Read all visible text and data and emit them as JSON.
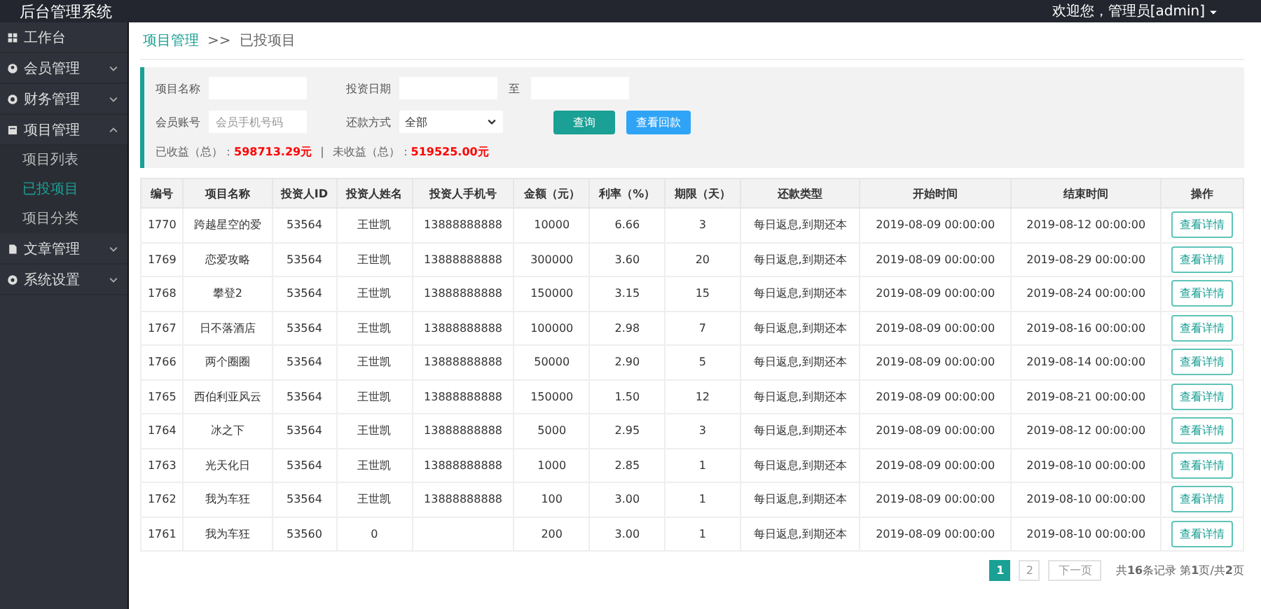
{
  "header": {
    "title": "后台管理系统",
    "user": "欢迎您，管理员[admin]"
  },
  "sidebar": {
    "items": [
      {
        "label": "工作台"
      },
      {
        "label": "会员管理",
        "expanded": false
      },
      {
        "label": "财务管理",
        "expanded": false
      },
      {
        "label": "项目管理",
        "expanded": true,
        "children": [
          {
            "label": "项目列表",
            "selected": false
          },
          {
            "label": "已投项目",
            "selected": true
          },
          {
            "label": "项目分类",
            "selected": false
          }
        ]
      },
      {
        "label": "文章管理",
        "expanded": false
      },
      {
        "label": "系统设置",
        "expanded": false
      }
    ]
  },
  "breadcrumb": {
    "parent": "项目管理",
    "separator": ">>",
    "current": "已投项目"
  },
  "filter": {
    "name_label": "项目名称",
    "date_label": "投资日期",
    "date_to": "至",
    "account_label": "会员账号",
    "account_placeholder": "会员手机号码",
    "repay_label": "还款方式",
    "repay_value": "全部",
    "buttons": [
      {
        "label": "查询",
        "kind": "primary"
      },
      {
        "label": "查看回款",
        "kind": "info"
      }
    ],
    "summary": {
      "earned_label": "已收益（总）：",
      "earned_value": "598713.29元",
      "divider": "|",
      "pending_label": "未收益（总）：",
      "pending_value": "519525.00元"
    }
  },
  "table": {
    "columns": [
      "编号",
      "项目名称",
      "投资人ID",
      "投资人姓名",
      "投资人手机号",
      "金额（元）",
      "利率（%）",
      "期限（天）",
      "还款类型",
      "开始时间",
      "结束时间",
      "操作"
    ],
    "rows": [
      [
        "1770",
        "跨越星空的爱",
        "53564",
        "王世凯",
        "13888888888",
        "10000",
        "6.66",
        "3",
        "每日返息,到期还本",
        "2019-08-09 00:00:00",
        "2019-08-12 00:00:00",
        "查看详情"
      ],
      [
        "1769",
        "恋爱攻略",
        "53564",
        "王世凯",
        "13888888888",
        "300000",
        "3.60",
        "20",
        "每日返息,到期还本",
        "2019-08-09 00:00:00",
        "2019-08-29 00:00:00",
        "查看详情"
      ],
      [
        "1768",
        "攀登2",
        "53564",
        "王世凯",
        "13888888888",
        "150000",
        "3.15",
        "15",
        "每日返息,到期还本",
        "2019-08-09 00:00:00",
        "2019-08-24 00:00:00",
        "查看详情"
      ],
      [
        "1767",
        "日不落酒店",
        "53564",
        "王世凯",
        "13888888888",
        "100000",
        "2.98",
        "7",
        "每日返息,到期还本",
        "2019-08-09 00:00:00",
        "2019-08-16 00:00:00",
        "查看详情"
      ],
      [
        "1766",
        "两个圈圈",
        "53564",
        "王世凯",
        "13888888888",
        "50000",
        "2.90",
        "5",
        "每日返息,到期还本",
        "2019-08-09 00:00:00",
        "2019-08-14 00:00:00",
        "查看详情"
      ],
      [
        "1765",
        "西伯利亚风云",
        "53564",
        "王世凯",
        "13888888888",
        "150000",
        "1.50",
        "12",
        "每日返息,到期还本",
        "2019-08-09 00:00:00",
        "2019-08-21 00:00:00",
        "查看详情"
      ],
      [
        "1764",
        "冰之下",
        "53564",
        "王世凯",
        "13888888888",
        "5000",
        "2.95",
        "3",
        "每日返息,到期还本",
        "2019-08-09 00:00:00",
        "2019-08-12 00:00:00",
        "查看详情"
      ],
      [
        "1763",
        "光天化日",
        "53564",
        "王世凯",
        "13888888888",
        "1000",
        "2.85",
        "1",
        "每日返息,到期还本",
        "2019-08-09 00:00:00",
        "2019-08-10 00:00:00",
        "查看详情"
      ],
      [
        "1762",
        "我为车狂",
        "53564",
        "王世凯",
        "13888888888",
        "100",
        "3.00",
        "1",
        "每日返息,到期还本",
        "2019-08-09 00:00:00",
        "2019-08-10 00:00:00",
        "查看详情"
      ],
      [
        "1761",
        "我为车狂",
        "53560",
        "0",
        "",
        "200",
        "3.00",
        "1",
        "每日返息,到期还本",
        "2019-08-09 00:00:00",
        "2019-08-10 00:00:00",
        "查看详情"
      ]
    ]
  },
  "pagination": {
    "pages": [
      {
        "label": "1",
        "selected": true
      },
      {
        "label": "2",
        "selected": false
      }
    ],
    "next": "下一页",
    "info": "共**16**条记录 第**1**页/共**2**页"
  }
}
